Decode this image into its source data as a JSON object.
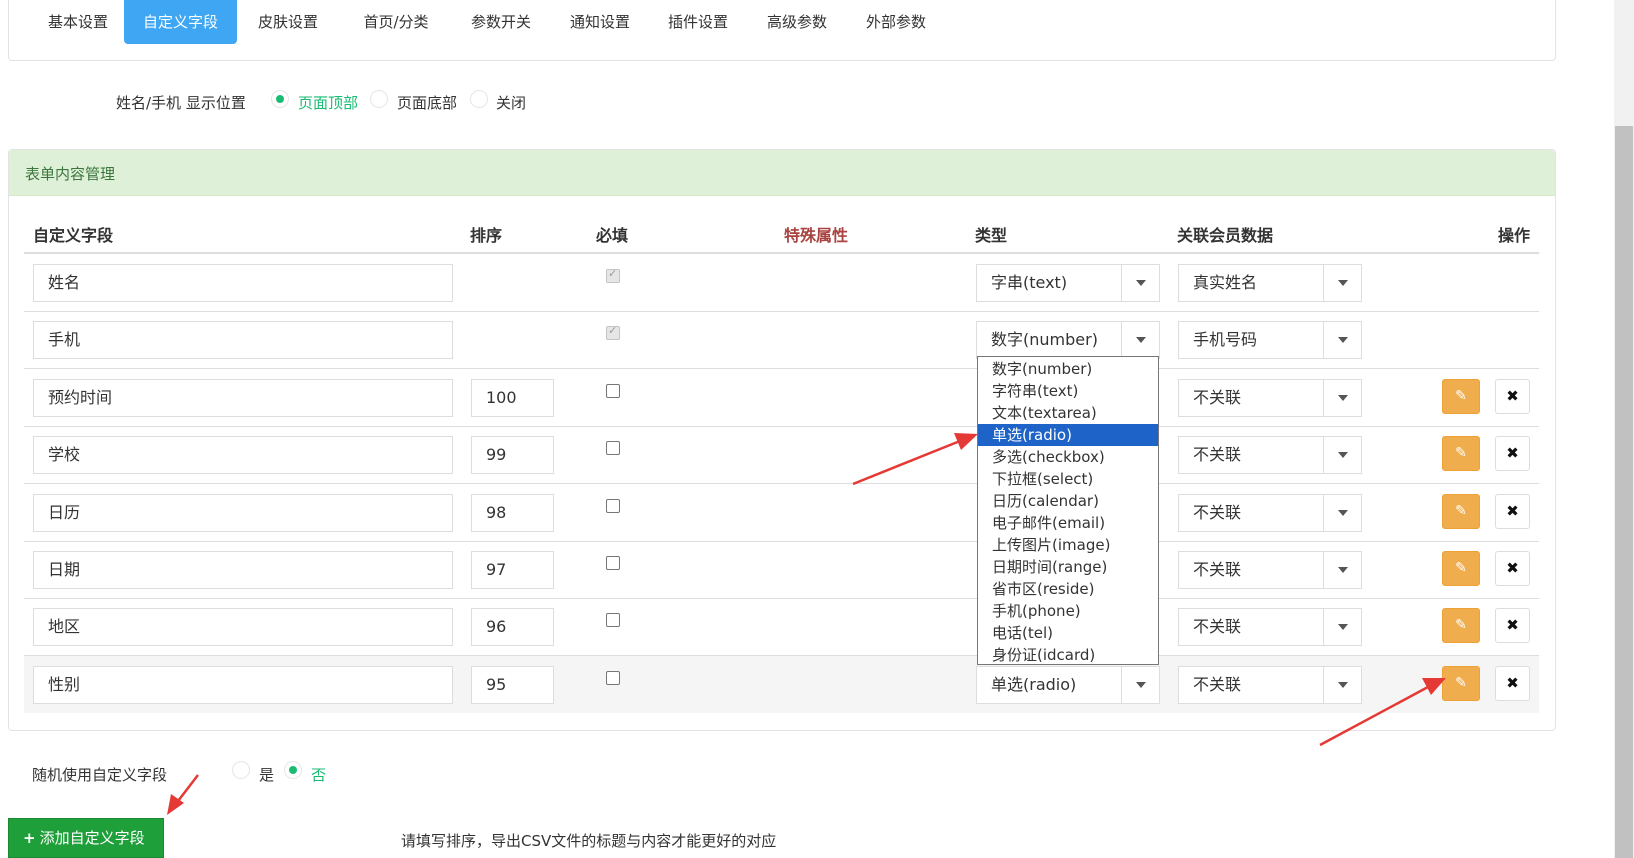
{
  "tabs": [
    "基本设置",
    "自定义字段",
    "皮肤设置",
    "首页/分类",
    "参数开关",
    "通知设置",
    "插件设置",
    "高级参数",
    "外部参数"
  ],
  "active_tab": 1,
  "name_position": {
    "label": "姓名/手机 显示位置",
    "options": [
      "页面顶部",
      "页面底部",
      "关闭"
    ],
    "selected": 0
  },
  "panel": {
    "title": "表单内容管理",
    "headers": {
      "field": "自定义字段",
      "sort": "排序",
      "required": "必填",
      "special": "特殊属性",
      "type": "类型",
      "member": "关联会员数据",
      "action": "操作"
    },
    "rows": [
      {
        "field": "姓名",
        "sort": "",
        "type": "字串(text)",
        "member": "真实姓名"
      },
      {
        "field": "手机",
        "sort": "",
        "type": "数字(number)",
        "member": "手机号码"
      },
      {
        "field": "预约时间",
        "sort": "100",
        "type": "",
        "member": "不关联"
      },
      {
        "field": "学校",
        "sort": "99",
        "type": "",
        "member": "不关联"
      },
      {
        "field": "日历",
        "sort": "98",
        "type": "",
        "member": "不关联"
      },
      {
        "field": "日期",
        "sort": "97",
        "type": "",
        "member": "不关联"
      },
      {
        "field": "地区",
        "sort": "96",
        "type": "",
        "member": "不关联"
      },
      {
        "field": "性别",
        "sort": "95",
        "type": "单选(radio)",
        "member": "不关联"
      }
    ]
  },
  "type_dropdown": {
    "options": [
      "数字(number)",
      "字符串(text)",
      "文本(textarea)",
      "单选(radio)",
      "多选(checkbox)",
      "下拉框(select)",
      "日历(calendar)",
      "电子邮件(email)",
      "上传图片(image)",
      "日期时间(range)",
      "省市区(reside)",
      "手机(phone)",
      "电话(tel)",
      "身份证(idcard)"
    ],
    "highlighted": 3
  },
  "random_field": {
    "label": "随机使用自定义字段",
    "options": [
      "是",
      "否"
    ],
    "selected": 1
  },
  "add_button": {
    "plus": "+",
    "label": "添加自定义字段"
  },
  "hint": "请填写排序，导出CSV文件的标题与内容才能更好的对应",
  "icons": {
    "edit": "edit-icon",
    "delete": "close-icon"
  },
  "colors": {
    "primary": "#3ea6f2",
    "success": "#1abc74",
    "warning": "#f0ad4e",
    "add": "#1e9f3a",
    "arrow": "#e53935"
  }
}
